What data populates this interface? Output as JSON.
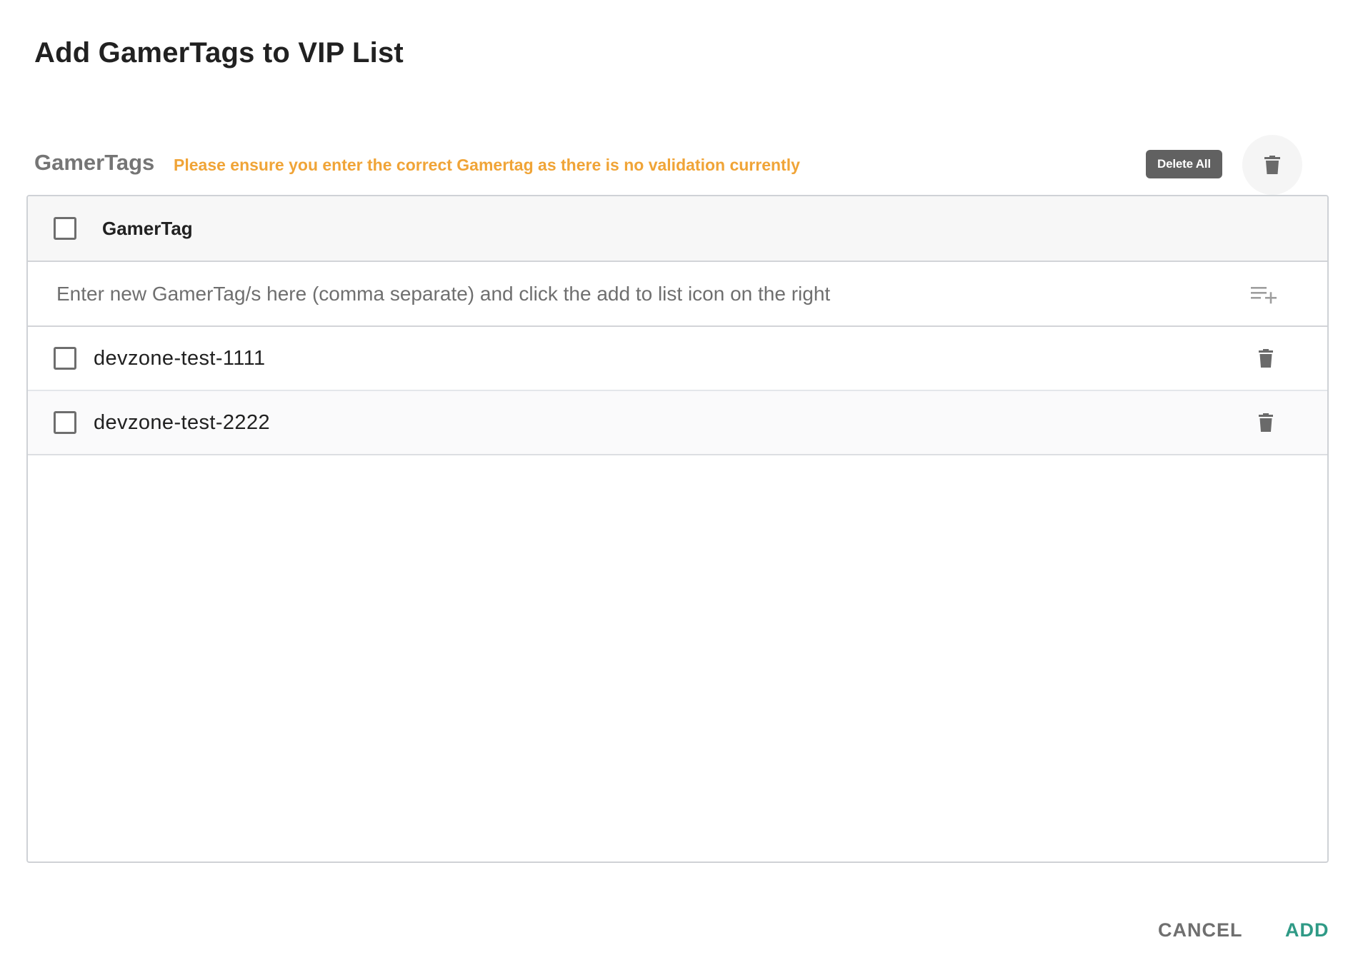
{
  "dialog": {
    "title": "Add GamerTags to VIP List"
  },
  "section": {
    "label": "GamerTags",
    "warning": "Please ensure you enter the correct Gamertag as there is no validation currently",
    "delete_all_label": "Delete All"
  },
  "table": {
    "header_label": "GamerTag",
    "input": {
      "placeholder": "Enter new GamerTag/s here (comma separate) and click the add to list icon on the right",
      "value": ""
    },
    "rows": [
      {
        "label": "devzone-test-1111"
      },
      {
        "label": "devzone-test-2222"
      }
    ]
  },
  "actions": {
    "cancel_label": "CANCEL",
    "add_label": "ADD"
  },
  "colors": {
    "warning": "#f0a437",
    "primary_action": "#2f9a86",
    "chip_bg": "#616161"
  },
  "icons": {
    "bulk_delete": "trash-icon",
    "add_to_list": "playlist-add-icon",
    "row_delete": "trash-icon"
  }
}
